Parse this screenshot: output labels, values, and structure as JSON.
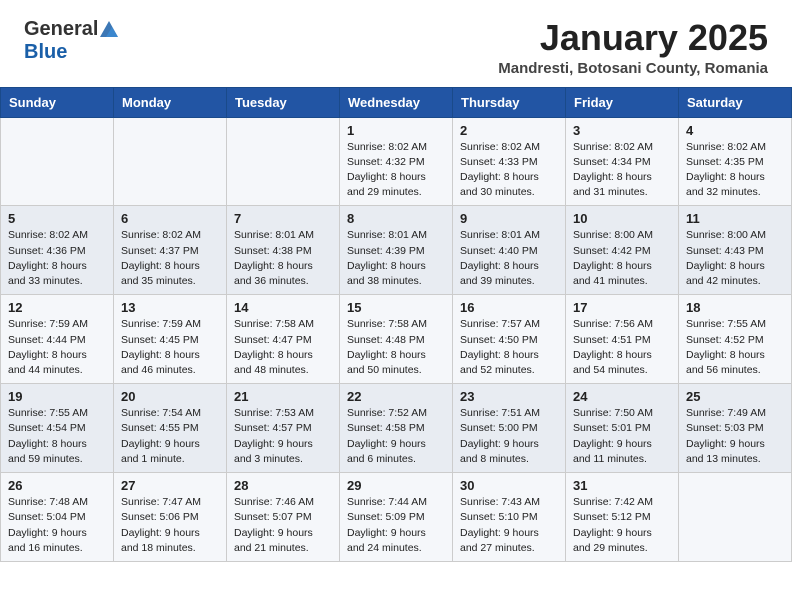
{
  "header": {
    "logo_general": "General",
    "logo_blue": "Blue",
    "title": "January 2025",
    "subtitle": "Mandresti, Botosani County, Romania"
  },
  "weekdays": [
    "Sunday",
    "Monday",
    "Tuesday",
    "Wednesday",
    "Thursday",
    "Friday",
    "Saturday"
  ],
  "weeks": [
    [
      {
        "day": "",
        "detail": ""
      },
      {
        "day": "",
        "detail": ""
      },
      {
        "day": "",
        "detail": ""
      },
      {
        "day": "1",
        "detail": "Sunrise: 8:02 AM\nSunset: 4:32 PM\nDaylight: 8 hours and 29 minutes."
      },
      {
        "day": "2",
        "detail": "Sunrise: 8:02 AM\nSunset: 4:33 PM\nDaylight: 8 hours and 30 minutes."
      },
      {
        "day": "3",
        "detail": "Sunrise: 8:02 AM\nSunset: 4:34 PM\nDaylight: 8 hours and 31 minutes."
      },
      {
        "day": "4",
        "detail": "Sunrise: 8:02 AM\nSunset: 4:35 PM\nDaylight: 8 hours and 32 minutes."
      }
    ],
    [
      {
        "day": "5",
        "detail": "Sunrise: 8:02 AM\nSunset: 4:36 PM\nDaylight: 8 hours and 33 minutes."
      },
      {
        "day": "6",
        "detail": "Sunrise: 8:02 AM\nSunset: 4:37 PM\nDaylight: 8 hours and 35 minutes."
      },
      {
        "day": "7",
        "detail": "Sunrise: 8:01 AM\nSunset: 4:38 PM\nDaylight: 8 hours and 36 minutes."
      },
      {
        "day": "8",
        "detail": "Sunrise: 8:01 AM\nSunset: 4:39 PM\nDaylight: 8 hours and 38 minutes."
      },
      {
        "day": "9",
        "detail": "Sunrise: 8:01 AM\nSunset: 4:40 PM\nDaylight: 8 hours and 39 minutes."
      },
      {
        "day": "10",
        "detail": "Sunrise: 8:00 AM\nSunset: 4:42 PM\nDaylight: 8 hours and 41 minutes."
      },
      {
        "day": "11",
        "detail": "Sunrise: 8:00 AM\nSunset: 4:43 PM\nDaylight: 8 hours and 42 minutes."
      }
    ],
    [
      {
        "day": "12",
        "detail": "Sunrise: 7:59 AM\nSunset: 4:44 PM\nDaylight: 8 hours and 44 minutes."
      },
      {
        "day": "13",
        "detail": "Sunrise: 7:59 AM\nSunset: 4:45 PM\nDaylight: 8 hours and 46 minutes."
      },
      {
        "day": "14",
        "detail": "Sunrise: 7:58 AM\nSunset: 4:47 PM\nDaylight: 8 hours and 48 minutes."
      },
      {
        "day": "15",
        "detail": "Sunrise: 7:58 AM\nSunset: 4:48 PM\nDaylight: 8 hours and 50 minutes."
      },
      {
        "day": "16",
        "detail": "Sunrise: 7:57 AM\nSunset: 4:50 PM\nDaylight: 8 hours and 52 minutes."
      },
      {
        "day": "17",
        "detail": "Sunrise: 7:56 AM\nSunset: 4:51 PM\nDaylight: 8 hours and 54 minutes."
      },
      {
        "day": "18",
        "detail": "Sunrise: 7:55 AM\nSunset: 4:52 PM\nDaylight: 8 hours and 56 minutes."
      }
    ],
    [
      {
        "day": "19",
        "detail": "Sunrise: 7:55 AM\nSunset: 4:54 PM\nDaylight: 8 hours and 59 minutes."
      },
      {
        "day": "20",
        "detail": "Sunrise: 7:54 AM\nSunset: 4:55 PM\nDaylight: 9 hours and 1 minute."
      },
      {
        "day": "21",
        "detail": "Sunrise: 7:53 AM\nSunset: 4:57 PM\nDaylight: 9 hours and 3 minutes."
      },
      {
        "day": "22",
        "detail": "Sunrise: 7:52 AM\nSunset: 4:58 PM\nDaylight: 9 hours and 6 minutes."
      },
      {
        "day": "23",
        "detail": "Sunrise: 7:51 AM\nSunset: 5:00 PM\nDaylight: 9 hours and 8 minutes."
      },
      {
        "day": "24",
        "detail": "Sunrise: 7:50 AM\nSunset: 5:01 PM\nDaylight: 9 hours and 11 minutes."
      },
      {
        "day": "25",
        "detail": "Sunrise: 7:49 AM\nSunset: 5:03 PM\nDaylight: 9 hours and 13 minutes."
      }
    ],
    [
      {
        "day": "26",
        "detail": "Sunrise: 7:48 AM\nSunset: 5:04 PM\nDaylight: 9 hours and 16 minutes."
      },
      {
        "day": "27",
        "detail": "Sunrise: 7:47 AM\nSunset: 5:06 PM\nDaylight: 9 hours and 18 minutes."
      },
      {
        "day": "28",
        "detail": "Sunrise: 7:46 AM\nSunset: 5:07 PM\nDaylight: 9 hours and 21 minutes."
      },
      {
        "day": "29",
        "detail": "Sunrise: 7:44 AM\nSunset: 5:09 PM\nDaylight: 9 hours and 24 minutes."
      },
      {
        "day": "30",
        "detail": "Sunrise: 7:43 AM\nSunset: 5:10 PM\nDaylight: 9 hours and 27 minutes."
      },
      {
        "day": "31",
        "detail": "Sunrise: 7:42 AM\nSunset: 5:12 PM\nDaylight: 9 hours and 29 minutes."
      },
      {
        "day": "",
        "detail": ""
      }
    ]
  ]
}
